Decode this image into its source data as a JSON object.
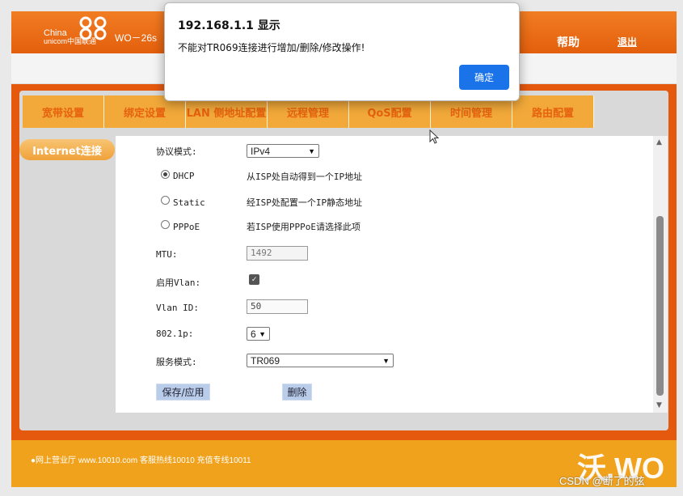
{
  "header": {
    "logo_line1": "China",
    "logo_line2": "unicom中国联通",
    "model": "WO－26s",
    "help": "帮助",
    "logout": "退出"
  },
  "tabs": [
    {
      "label": "宽带设置"
    },
    {
      "label": "绑定设置"
    },
    {
      "label": "LAN 侧地址配置"
    },
    {
      "label": "远程管理"
    },
    {
      "label": "QoS配置"
    },
    {
      "label": "时间管理"
    },
    {
      "label": "路由配置"
    }
  ],
  "side_tab": "Internet连接",
  "form": {
    "protocol_label": "协议模式:",
    "protocol_value": "IPv4",
    "dhcp_label": "DHCP",
    "dhcp_desc": "从ISP处自动得到一个IP地址",
    "static_label": "Static",
    "static_desc": "经ISP处配置一个IP静态地址",
    "pppoe_label": "PPPoE",
    "pppoe_desc": "若ISP使用PPPoE请选择此项",
    "mtu_label": "MTU:",
    "mtu_value": "1492",
    "vlan_enable_label": "启用Vlan:",
    "vlan_id_label": "Vlan ID:",
    "vlan_id_value": "50",
    "p8021_label": "802.1p:",
    "p8021_value": "6",
    "service_label": "服务模式:",
    "service_value": "TR069",
    "save_button": "保存/应用",
    "delete_button": "删除"
  },
  "footer": {
    "text": "●网上营业厅 www.10010.com   客服热线10010   充值专线10011",
    "logo": "沃.WO"
  },
  "watermark": "CSDN @断了的弦",
  "dialog": {
    "title": "192.168.1.1 显示",
    "message": "不能对TR069连接进行增加/删除/修改操作!",
    "ok": "确定"
  },
  "colors": {
    "header": "#e35f0c",
    "tab": "#f2a93a",
    "footer": "#f0a21c",
    "ok_button": "#1a73e8"
  }
}
